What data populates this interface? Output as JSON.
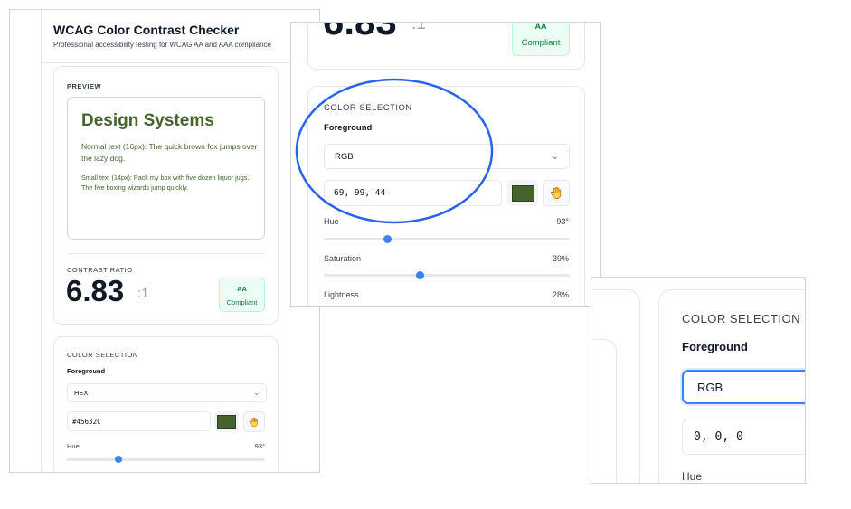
{
  "app": {
    "title": "WCAG Color Contrast Checker",
    "subtitle": "Professional accessibility testing for WCAG AA and AAA compliance"
  },
  "preview": {
    "section_label": "PREVIEW",
    "heading": "Design Systems",
    "normal_text": "Normal text (16px): The quick brown fox jumps over the lazy dog.",
    "small_text": "Small text (14px): Pack my box with five dozen liquor jugs. The five boxing wizards jump quickly.",
    "text_color": "#45632C"
  },
  "contrast": {
    "label": "CONTRAST RATIO",
    "value": "6.83",
    "suffix": ":1",
    "badge_level": "AA",
    "badge_status": "Compliant"
  },
  "color_selection": {
    "label": "COLOR SELECTION",
    "foreground_label": "Foreground",
    "format_hex": "HEX",
    "format_rgb": "RGB",
    "hex_value": "#45632C",
    "rgb_value": "69, 99, 44",
    "rgb_zero_value": "0, 0, 0",
    "swatch_color": "#45632C",
    "hue_label": "Hue",
    "hue_value": "93°",
    "hue_fraction": 0.258,
    "saturation_label": "Saturation",
    "saturation_value": "39%",
    "saturation_fraction": 0.39,
    "lightness_label": "Lightness",
    "lightness_value": "28%",
    "lightness_fraction": 0.28
  },
  "icons": {
    "chevron": "chevron-down-icon",
    "eyedropper": "hand-icon"
  },
  "colors": {
    "accent": "#3B82F6",
    "highlight_ring": "#2563EB",
    "badge_bg": "#ECFDF5",
    "badge_text": "#15803D"
  }
}
